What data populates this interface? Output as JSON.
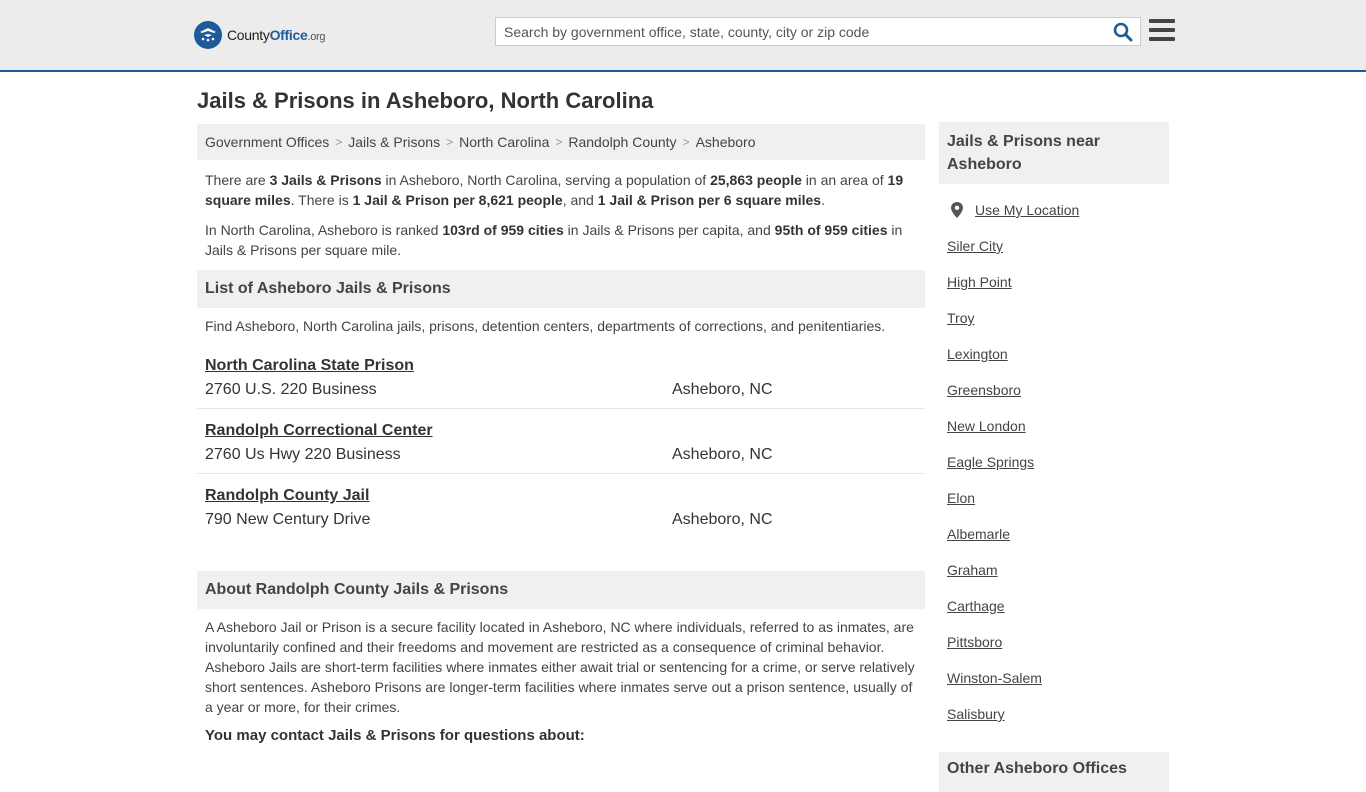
{
  "header": {
    "logo_main": "County",
    "logo_brand": "Office",
    "logo_tld": ".org",
    "search_placeholder": "Search by government office, state, county, city or zip code"
  },
  "page": {
    "title": "Jails & Prisons in Asheboro, North Carolina"
  },
  "breadcrumb": [
    "Government Offices",
    "Jails & Prisons",
    "North Carolina",
    "Randolph County",
    "Asheboro"
  ],
  "intro": {
    "p1": [
      {
        "t": "There are ",
        "b": false
      },
      {
        "t": "3 Jails & Prisons",
        "b": true
      },
      {
        "t": " in Asheboro, North Carolina, serving a population of ",
        "b": false
      },
      {
        "t": "25,863 people",
        "b": true
      },
      {
        "t": " in an area of ",
        "b": false
      },
      {
        "t": "19 square miles",
        "b": true
      },
      {
        "t": ". There is ",
        "b": false
      },
      {
        "t": "1 Jail & Prison per 8,621 people",
        "b": true
      },
      {
        "t": ", and ",
        "b": false
      },
      {
        "t": "1 Jail & Prison per 6 square miles",
        "b": true
      },
      {
        "t": ".",
        "b": false
      }
    ],
    "p2": [
      {
        "t": "In North Carolina, Asheboro is ranked ",
        "b": false
      },
      {
        "t": "103rd of 959 cities",
        "b": true
      },
      {
        "t": " in Jails & Prisons per capita, and ",
        "b": false
      },
      {
        "t": "95th of 959 cities",
        "b": true
      },
      {
        "t": " in Jails & Prisons per square mile.",
        "b": false
      }
    ]
  },
  "list": {
    "heading": "List of Asheboro Jails & Prisons",
    "description": "Find Asheboro, North Carolina jails, prisons, detention centers, departments of corrections, and penitentiaries.",
    "items": [
      {
        "name": "North Carolina State Prison",
        "address": "2760 U.S. 220 Business",
        "city": "Asheboro, NC"
      },
      {
        "name": "Randolph Correctional Center",
        "address": "2760 Us Hwy 220 Business",
        "city": "Asheboro, NC"
      },
      {
        "name": "Randolph County Jail",
        "address": "790 New Century Drive",
        "city": "Asheboro, NC"
      }
    ]
  },
  "about": {
    "heading": "About Randolph County Jails & Prisons",
    "text": "A Asheboro Jail or Prison is a secure facility located in Asheboro, NC where individuals, referred to as inmates, are involuntarily confined and their freedoms and movement are restricted as a consequence of criminal behavior. Asheboro Jails are short-term facilities where inmates either await trial or sentencing for a crime, or serve relatively short sentences. Asheboro Prisons are longer-term facilities where inmates serve out a prison sentence, usually of a year or more, for their crimes.",
    "contact_heading": "You may contact Jails & Prisons for questions about:"
  },
  "sidebar": {
    "heading": "Jails & Prisons near Asheboro",
    "use_location": "Use My Location",
    "cities": [
      "Siler City",
      "High Point",
      "Troy",
      "Lexington",
      "Greensboro",
      "New London",
      "Eagle Springs",
      "Elon",
      "Albemarle",
      "Graham",
      "Carthage",
      "Pittsboro",
      "Winston-Salem",
      "Salisbury"
    ],
    "heading2": "Other Asheboro Offices"
  }
}
